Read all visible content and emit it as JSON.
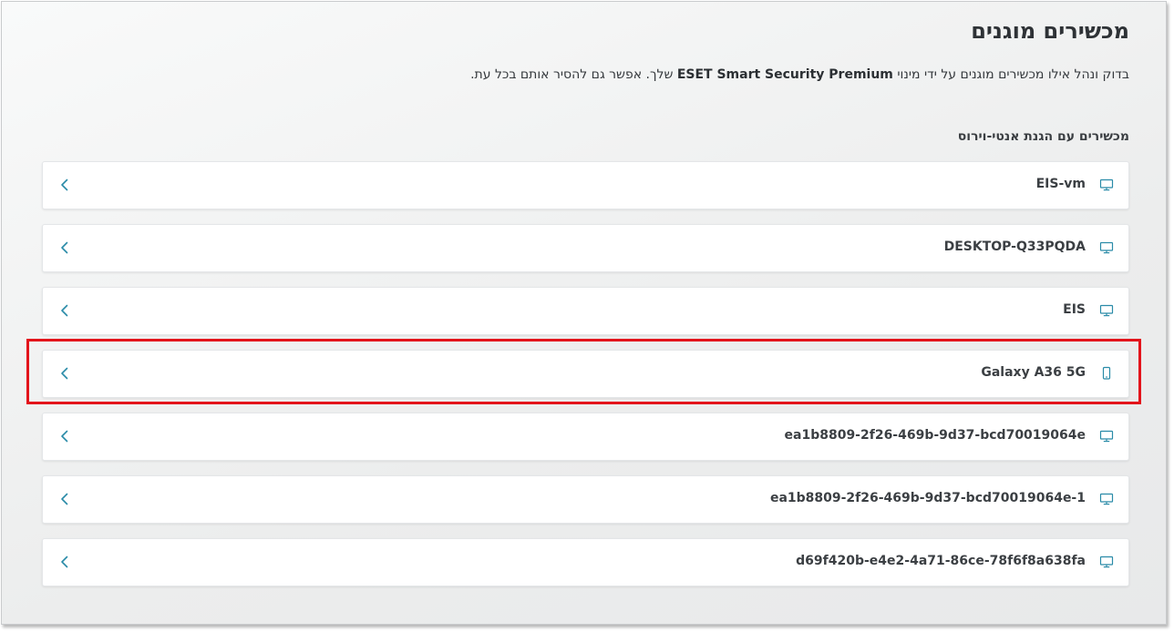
{
  "page": {
    "title": "מכשירים מוגנים",
    "description_part1": "בדוק ונהל אילו מכשירים מוגנים על ידי מינוי ",
    "description_product": "ESET Smart Security Premium",
    "description_part2": " שלך. אפשר גם להסיר אותם בכל עת.",
    "section_title": "מכשירים עם הגנת אנטי-וירוס"
  },
  "devices": [
    {
      "name": "EIS-vm",
      "icon": "monitor-icon"
    },
    {
      "name": "DESKTOP-Q33PQDA",
      "icon": "monitor-icon"
    },
    {
      "name": "EIS",
      "icon": "monitor-icon"
    },
    {
      "name": "Galaxy A36 5G",
      "icon": "phone-icon"
    },
    {
      "name": "ea1b8809-2f26-469b-9d37-bcd70019064e",
      "icon": "monitor-icon"
    },
    {
      "name": "ea1b8809-2f26-469b-9d37-bcd70019064e-1",
      "icon": "monitor-icon"
    },
    {
      "name": "d69f420b-e4e2-4a71-86ce-78f6f8a638fa",
      "icon": "monitor-icon"
    }
  ],
  "colors": {
    "icon_teal": "#2a8ba8",
    "highlight_red": "#e3141b"
  }
}
